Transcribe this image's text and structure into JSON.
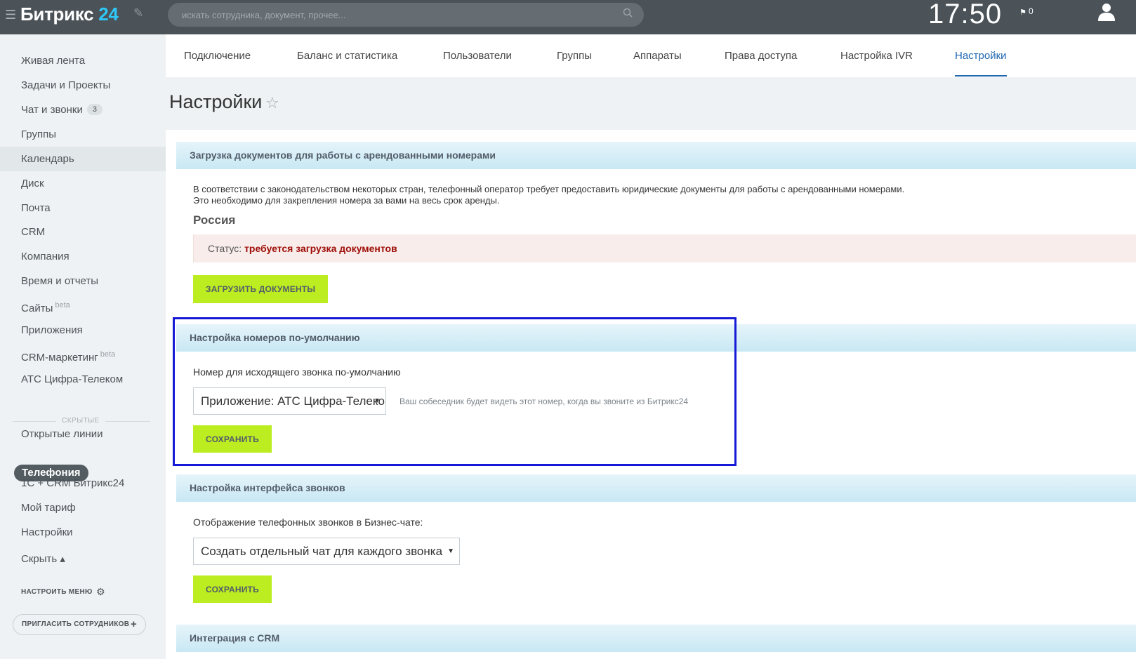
{
  "topbar": {
    "logo_text": "Битрикс",
    "logo_num": "24",
    "search_placeholder": "искать сотрудника, документ, прочее...",
    "clock": "17:50",
    "flag_count": "0"
  },
  "sidebar": {
    "items": [
      {
        "label": "Живая лента"
      },
      {
        "label": "Задачи и Проекты"
      },
      {
        "label": "Чат и звонки",
        "badge": "3"
      },
      {
        "label": "Группы"
      },
      {
        "label": "Календарь"
      },
      {
        "label": "Диск"
      },
      {
        "label": "Почта"
      },
      {
        "label": "CRM"
      },
      {
        "label": "Компания"
      },
      {
        "label": "Время и отчеты"
      },
      {
        "label": "Сайты",
        "sup": "beta"
      },
      {
        "label": "Приложения"
      },
      {
        "label": "CRM-маркетинг",
        "sup": "beta"
      },
      {
        "label": "АТС Цифра-Телеком"
      }
    ],
    "hidden_label": "скрытые",
    "hidden_items": [
      {
        "label": "Открытые линии"
      },
      {
        "label": "Телефония"
      },
      {
        "label": "1С + CRM Битрикс24"
      },
      {
        "label": "Мой тариф"
      },
      {
        "label": "Настройки"
      },
      {
        "label": "Скрыть ▴"
      }
    ],
    "configure_menu": "Настроить меню",
    "invite": "Пригласить сотрудников"
  },
  "tabs": [
    {
      "label": "Подключение"
    },
    {
      "label": "Баланс и статистика"
    },
    {
      "label": "Пользователи"
    },
    {
      "label": "Группы"
    },
    {
      "label": "Аппараты"
    },
    {
      "label": "Права доступа"
    },
    {
      "label": "Настройка IVR"
    },
    {
      "label": "Настройки"
    }
  ],
  "page_title": "Настройки",
  "documents": {
    "header": "Загрузка документов для работы с арендованными номерами",
    "line1": "В соответствии с законодательством некоторых стран, телефонный оператор требует предоставить юридические документы для работы с арендованными номерами.",
    "line2": "Это необходимо для закрепления номера за вами на весь срок аренды.",
    "country": "Россия",
    "status_label": "Статус:",
    "status_value": "требуется загрузка документов",
    "upload_button": "Загрузить документы"
  },
  "default_numbers": {
    "header": "Настройка номеров по-умолчанию",
    "field_label": "Номер для исходящего звонка по-умолчанию",
    "select_value": "Приложение: АТС Цифра-Телеком",
    "hint": "Ваш собеседник будет видеть этот номер, когда вы звоните из Битрикс24",
    "save_button": "Сохранить"
  },
  "call_interface": {
    "header": "Настройка интерфейса звонков",
    "field_label": "Отображение телефонных звонков в Бизнес-чате:",
    "select_value": "Создать отдельный чат для каждого звонка",
    "save_button": "Сохранить"
  },
  "crm": {
    "header": "Интеграция с CRM"
  },
  "colors": {
    "accent_button": "#bbed21",
    "tab_active": "#2067b0",
    "status_error": "#9e0f07",
    "highlight_frame": "#1619d6"
  }
}
